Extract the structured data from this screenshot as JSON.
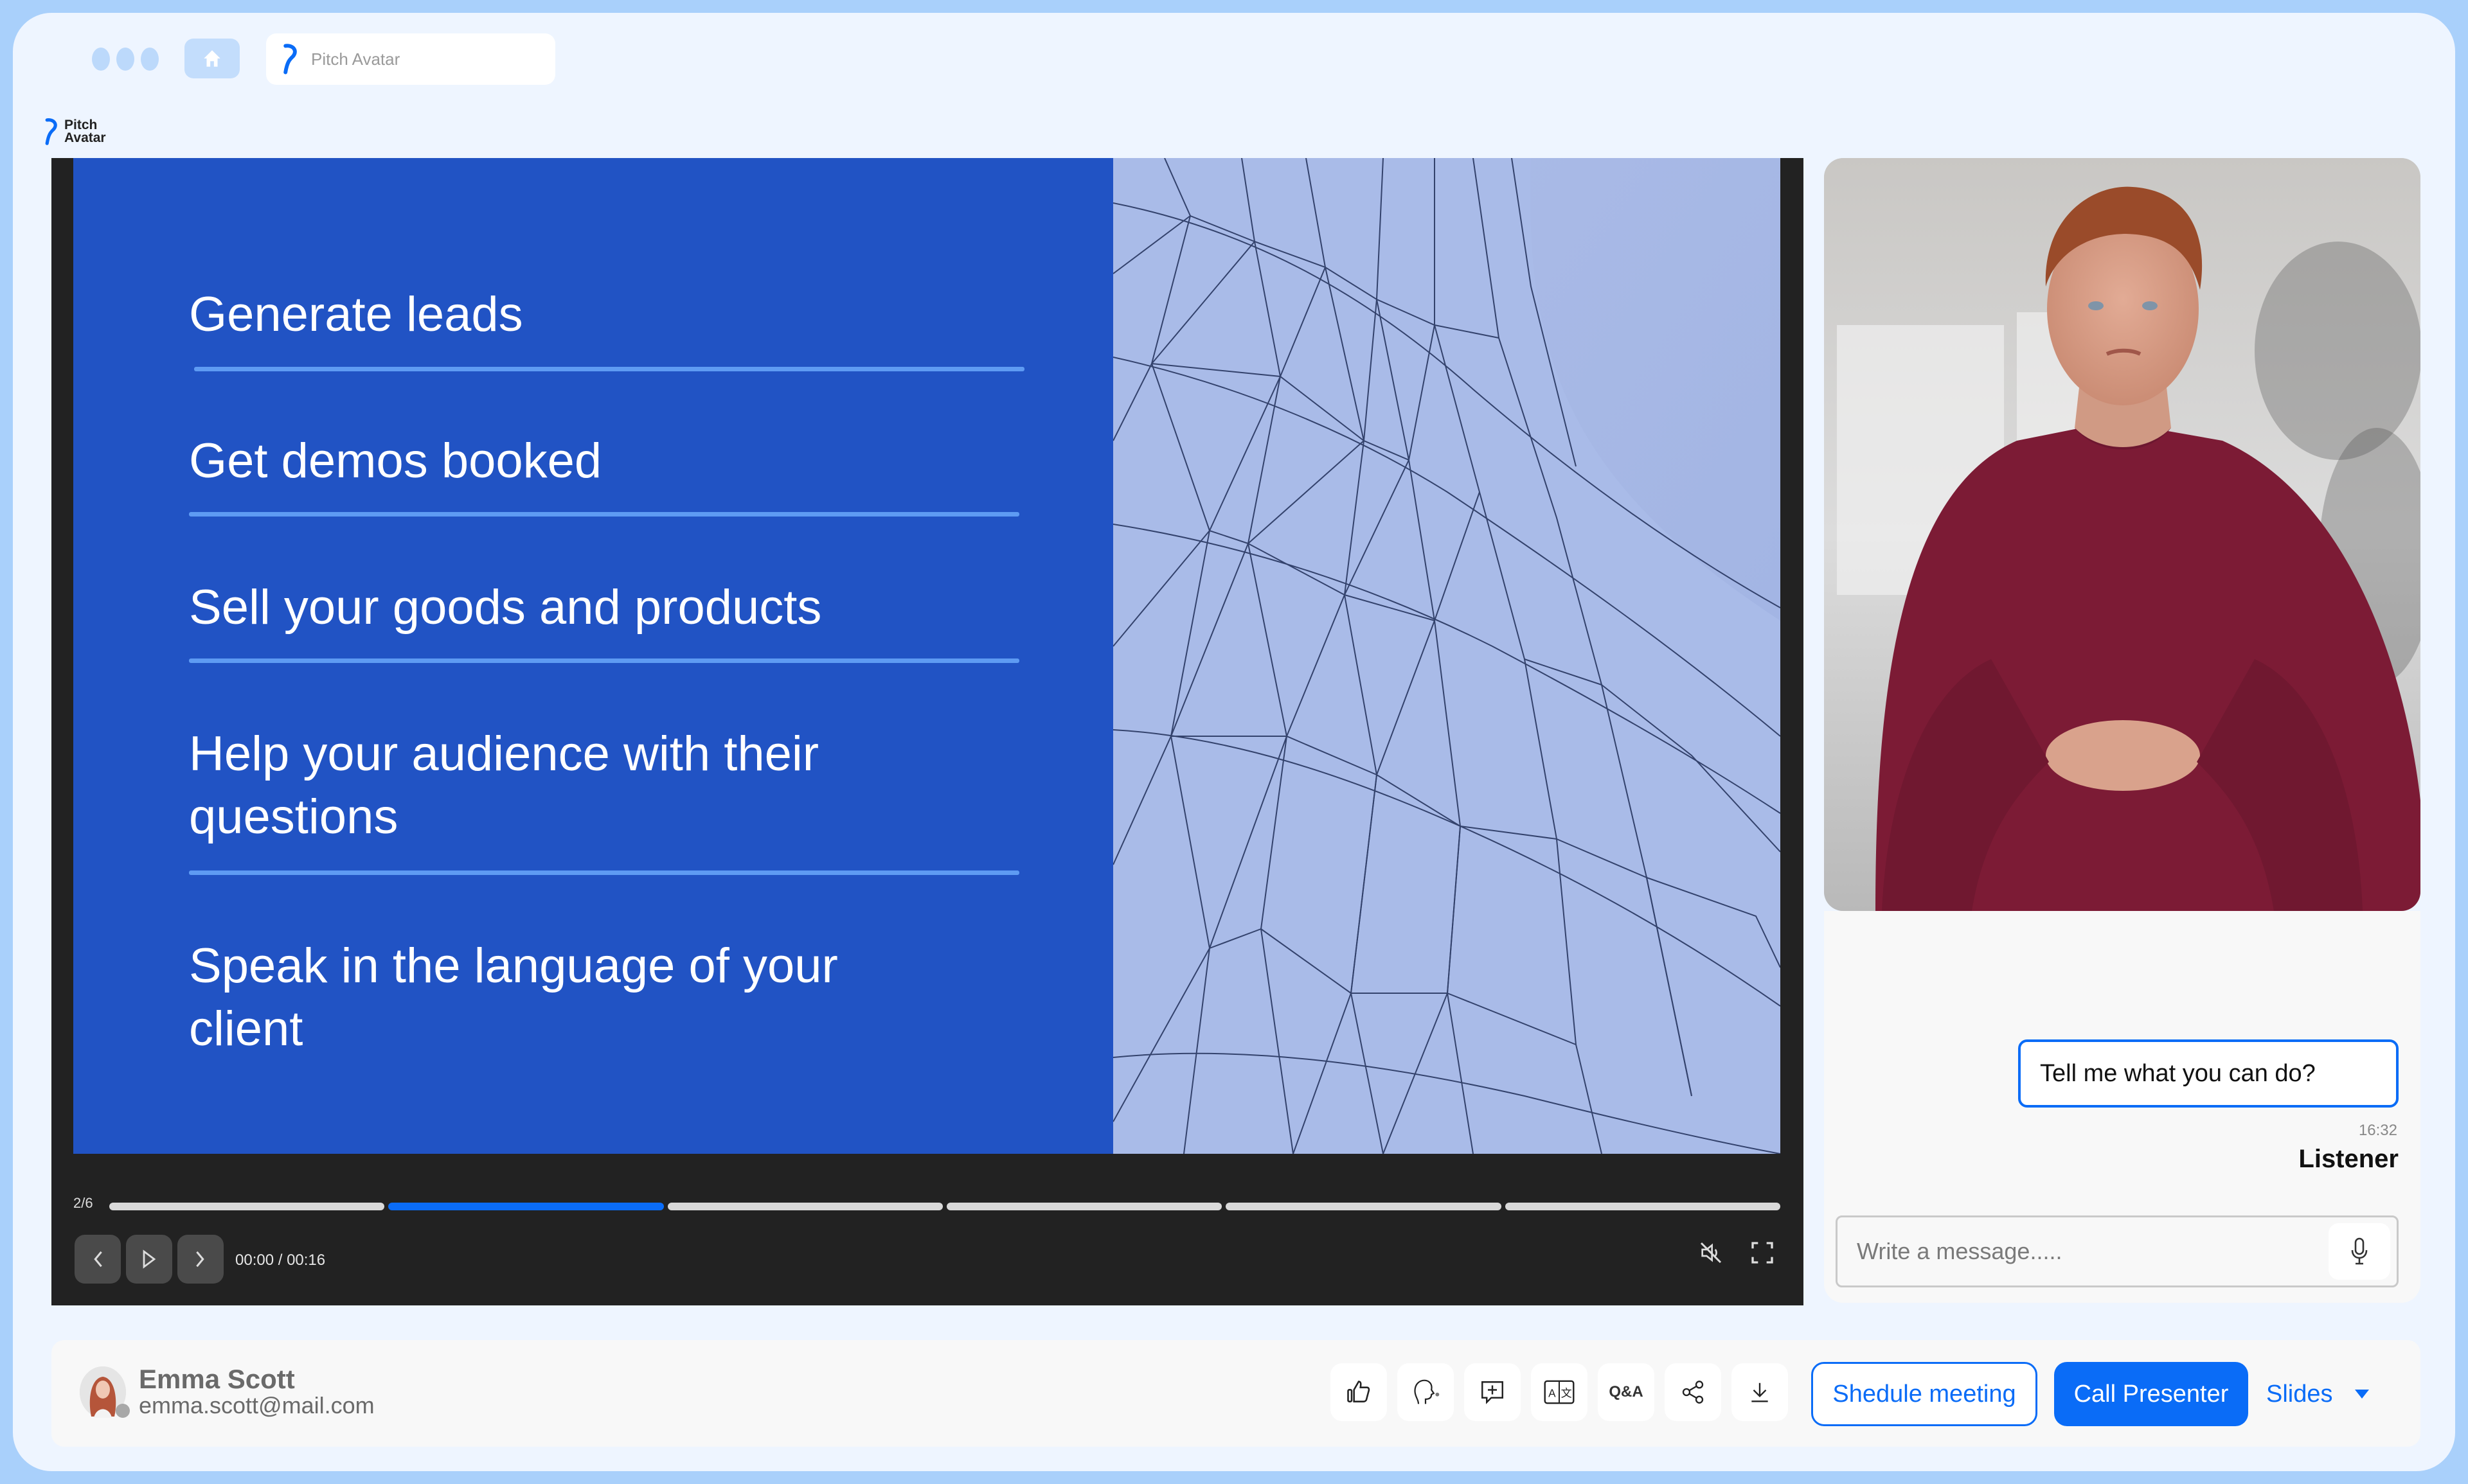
{
  "browser": {
    "address_text": "Pitch Avatar"
  },
  "brand": {
    "name_line1": "Pitch",
    "name_line2": "Avatar"
  },
  "slide": {
    "items": [
      "Generate leads",
      "Get demos booked",
      "Sell your goods and products",
      "Help your audience with their questions",
      "Speak in the language of your client"
    ]
  },
  "player": {
    "slide_counter": "2/6",
    "current_slide": 2,
    "total_slides": 6,
    "time_display": "00:00 / 00:16",
    "muted": true
  },
  "chat": {
    "messages": [
      {
        "text": "Tell me what you can do?",
        "time": "16:32",
        "author": "Listener"
      }
    ],
    "input_placeholder": "Write a message.....",
    "input_value": ""
  },
  "user": {
    "name": "Emma Scott",
    "email": "emma.scott@mail.com"
  },
  "toolbar": {
    "tools": [
      {
        "icon": "thumbs-up-icon"
      },
      {
        "icon": "voice-assistant-icon"
      },
      {
        "icon": "add-comment-icon"
      },
      {
        "icon": "translate-icon"
      },
      {
        "icon": "qa-icon",
        "label": "Q&A"
      },
      {
        "icon": "share-icon"
      },
      {
        "icon": "download-icon"
      }
    ],
    "schedule_label": "Shedule meeting",
    "call_label": "Call Presenter",
    "slides_label": "Slides"
  },
  "colors": {
    "accent": "#0a6cf7",
    "slide_blue": "#2153c4",
    "slide_rule": "#5e9bf3",
    "player_bg": "#222222",
    "frame_bg": "#eef5ff",
    "frame_border": "#a9d0fb"
  }
}
